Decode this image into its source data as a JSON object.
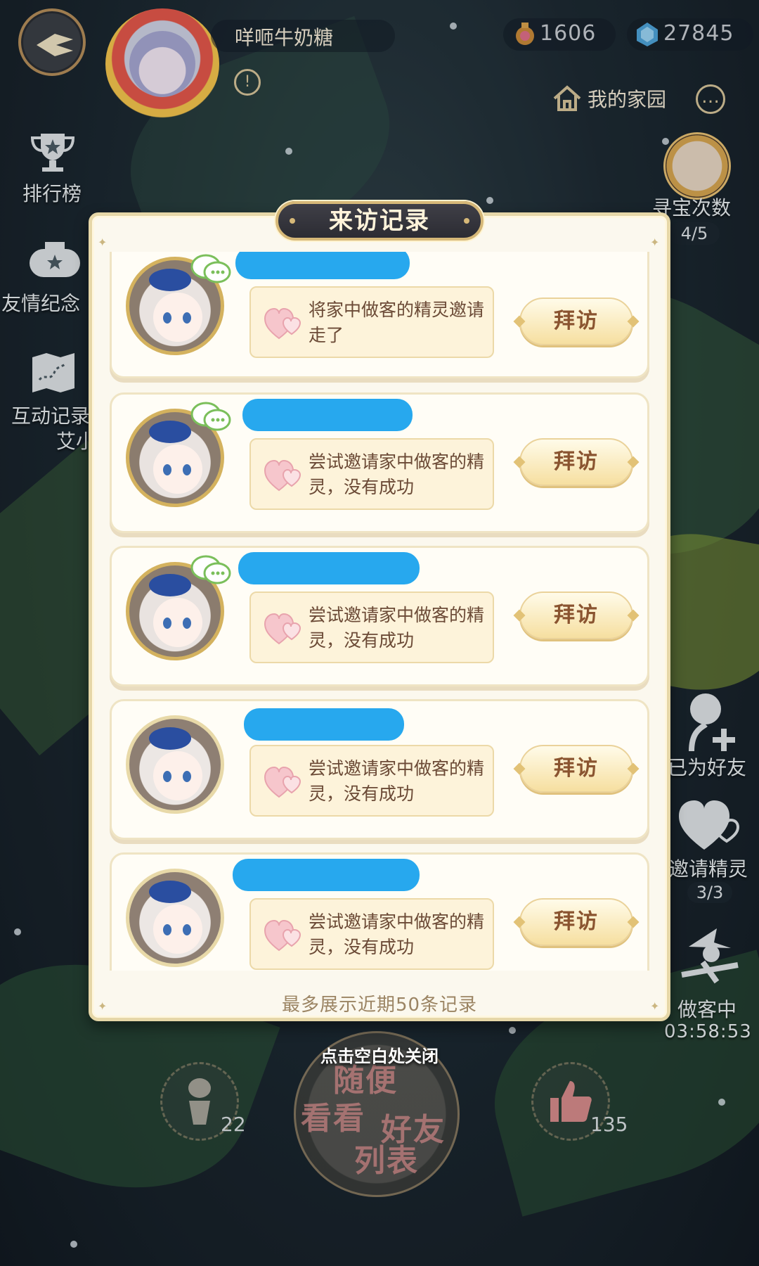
{
  "header": {
    "player_name": "咩咂牛奶糖",
    "currency_coins": "1606",
    "currency_gems": "27845",
    "home_label": "我的家园"
  },
  "left_menu": {
    "ranking_label": "排行榜",
    "friendship_label": "友情纪念",
    "interaction_label": "互动记录",
    "interaction_sub": "艾小"
  },
  "right_menu": {
    "treasure_label": "寻宝次数",
    "treasure_count": "4/5",
    "friend_label": "已为好友",
    "invite_label": "邀请精灵",
    "invite_count": "3/3",
    "guest_label": "做客中",
    "guest_timer": "03:58:53"
  },
  "bottom": {
    "left_count": "22",
    "right_count": "135",
    "big_line1": "随便",
    "big_line2a": "看看",
    "big_line2b": "好友",
    "big_line3": "列表",
    "close_hint": "点击空白处关闭"
  },
  "dialog": {
    "title": "来访记录",
    "visit_label": "拜访",
    "footnote": "最多展示近期50条记录",
    "records": [
      {
        "message": "将家中做客的精灵邀请走了"
      },
      {
        "message": "尝试邀请家中做客的精灵，没有成功"
      },
      {
        "message": "尝试邀请家中做客的精灵，没有成功"
      },
      {
        "message": "尝试邀请家中做客的精灵，没有成功"
      },
      {
        "message": "尝试邀请家中做客的精灵，没有成功"
      }
    ]
  },
  "icons": {
    "back": "back-arrow-icon",
    "warning": "warning-icon",
    "coin": "coin-icon",
    "gem": "gem-icon",
    "home": "home-icon",
    "more": "more-icon",
    "trophy": "trophy-icon",
    "badge": "badge-icon",
    "map": "map-icon",
    "chat": "chat-icon",
    "heart": "heart-icon",
    "add_friend": "add-friend-icon",
    "invite_heart": "invite-heart-icon",
    "witch": "witch-icon",
    "gift": "gift-icon",
    "thumbs_up": "thumbs-up-icon"
  },
  "colors": {
    "accent_gold": "#d6b878",
    "visit_text": "#8a5430",
    "message_text": "#6b4a36",
    "redaction_blue": "#27a8ee"
  }
}
